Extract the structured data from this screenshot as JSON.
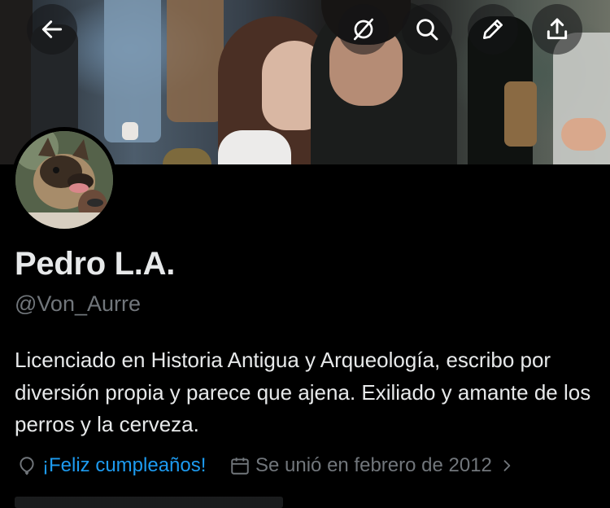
{
  "profile": {
    "name": "Pedro L.A.",
    "handle": "@Von_Aurre",
    "bio": "Licenciado en Historia Antigua y Arqueología, escribo por diversión propia y parece que ajena. Exiliado y amante de los perros y la cerveza.",
    "birthday_text": "¡Feliz cumpleaños!",
    "joined_text": "Se unió en febrero de 2012"
  },
  "header_buttons": {
    "back": "back-arrow-icon",
    "grok": "grok-icon",
    "search": "search-icon",
    "edit": "pencil-icon",
    "share": "share-icon"
  },
  "colors": {
    "background": "#000000",
    "text_primary": "#e7e9ea",
    "text_secondary": "#71767b",
    "accent": "#1d9bf0"
  }
}
